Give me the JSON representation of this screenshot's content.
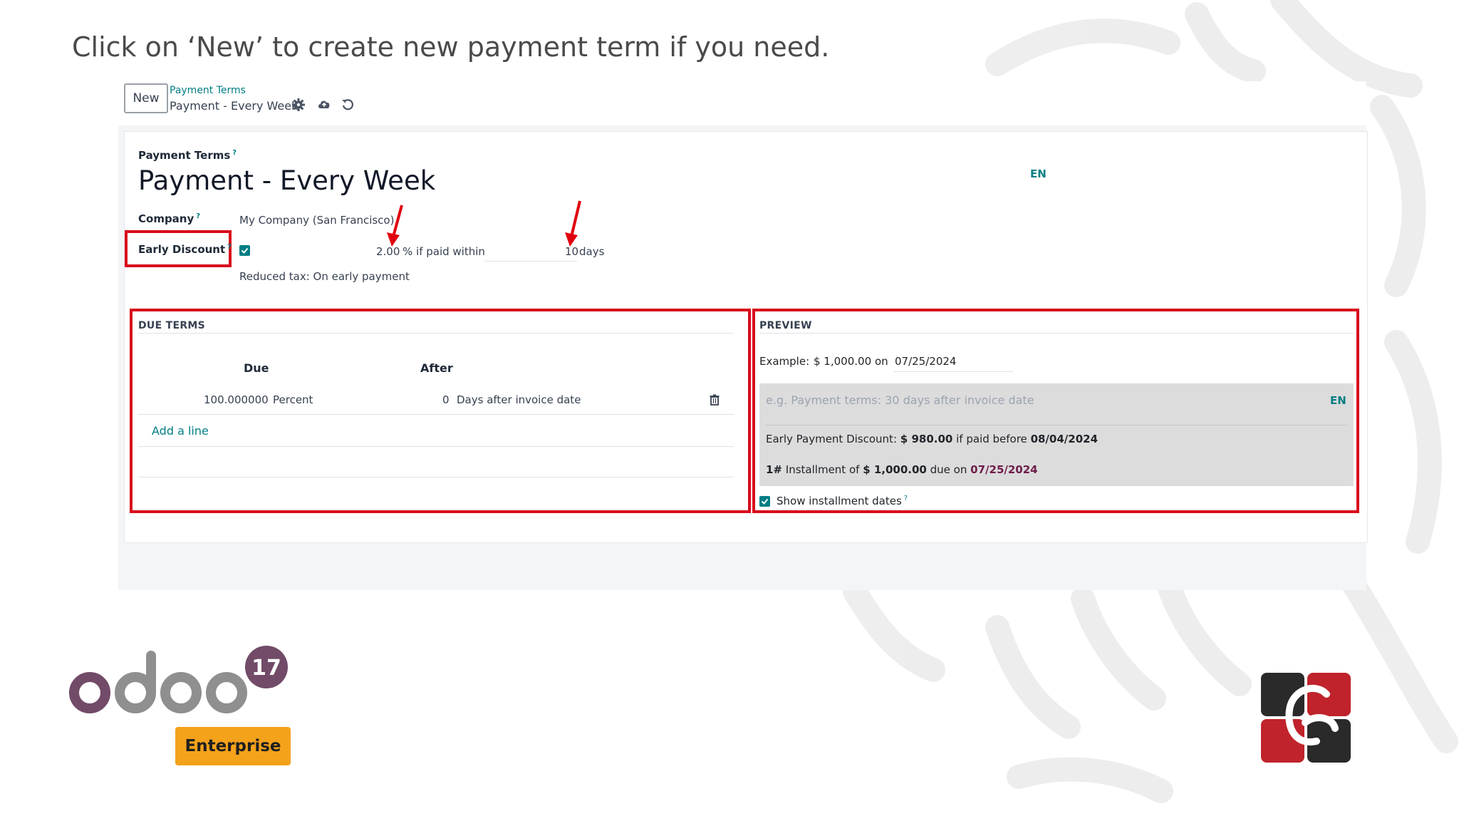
{
  "slide": {
    "heading": "Click on ‘New’ to create new payment term if you need."
  },
  "control_panel": {
    "new_button": "New",
    "breadcrumb_parent": "Payment Terms",
    "breadcrumb_current": "Payment - Every Week",
    "icons": [
      "gear-icon",
      "cloud-save-icon",
      "discard-icon"
    ]
  },
  "form": {
    "name_label": "Payment Terms",
    "name_value": "Payment - Every Week",
    "lang_badge": "EN",
    "company_label": "Company",
    "company_value": "My Company (San Francisco)",
    "early_discount_label": "Early Discount",
    "early_discount_checked": true,
    "discount_percent": "2.00",
    "percent_suffix": "% if paid within",
    "discount_days": "10",
    "days_suffix": "days",
    "reduced_tax": "Reduced tax: On early payment"
  },
  "due_terms": {
    "title": "DUE TERMS",
    "columns": [
      "Due",
      "After"
    ],
    "rows": [
      {
        "due_value": "100.000000",
        "due_type": "Percent",
        "after_value": "0",
        "after_type": "Days after invoice date"
      }
    ],
    "add_line": "Add a line"
  },
  "preview": {
    "title": "PREVIEW",
    "example_label": "Example:",
    "example_amount": "$ 1,000.00",
    "on_label": "on",
    "example_date": "07/25/2024",
    "note_placeholder": "e.g. Payment terms: 30 days after invoice date",
    "note_lang": "EN",
    "early_label": "Early Payment Discount:",
    "early_amount": "$ 980.00",
    "early_middle": "if paid before",
    "early_date": "08/04/2024",
    "inst_prefix": "1#",
    "inst_label": "Installment of",
    "inst_amount": "$ 1,000.00",
    "inst_middle": "due on",
    "inst_date": "07/25/2024",
    "show_dates_label": "Show installment dates",
    "show_dates_checked": true
  },
  "branding": {
    "odoo_version": "17",
    "edition": "Enterprise",
    "colors": {
      "odoo_purple": "#714B67",
      "odoo_grey": "#8F8F8F",
      "accent_teal": "#017E84",
      "highlight_red": "#D90C1C",
      "enterprise_orange": "#F5A21B"
    }
  }
}
